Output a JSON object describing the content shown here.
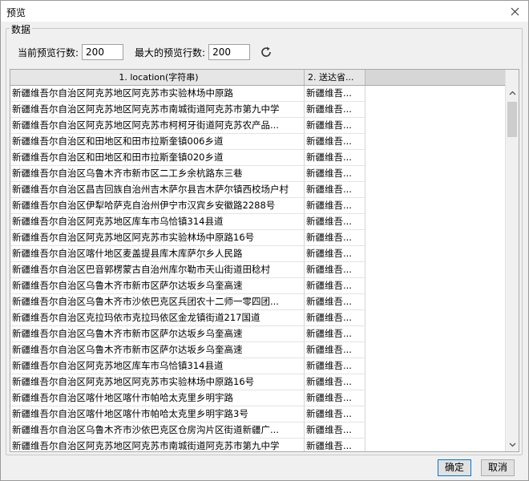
{
  "window": {
    "title": "预览"
  },
  "group": {
    "legend": "数据"
  },
  "controls": {
    "current_label": "当前预览行数:",
    "current_value": "200",
    "max_label": "最大的预览行数:",
    "max_value": "200"
  },
  "table": {
    "columns": [
      "1. location(字符串)",
      "2. 送达省..."
    ],
    "rows": [
      [
        "新疆维吾尔自治区阿克苏地区阿克苏市实验林场中原路",
        "新疆维吾..."
      ],
      [
        "新疆维吾尔自治区阿克苏地区阿克苏市南城街道阿克苏市第九中学",
        "新疆维吾..."
      ],
      [
        "新疆维吾尔自治区阿克苏地区阿克苏市柯柯牙街道阿克苏农产品...",
        "新疆维吾..."
      ],
      [
        "新疆维吾尔自治区和田地区和田市拉斯奎镇006乡道",
        "新疆维吾..."
      ],
      [
        "新疆维吾尔自治区和田地区和田市拉斯奎镇020乡道",
        "新疆维吾..."
      ],
      [
        "新疆维吾尔自治区乌鲁木齐市新市区二工乡余杭路东三巷",
        "新疆维吾..."
      ],
      [
        "新疆维吾尔自治区昌吉回族自治州吉木萨尔县吉木萨尔镇西校场户村",
        "新疆维吾..."
      ],
      [
        "新疆维吾尔自治区伊犁哈萨克自治州伊宁市汉宾乡安徽路2288号",
        "新疆维吾..."
      ],
      [
        "新疆维吾尔自治区阿克苏地区库车市乌恰镇314县道",
        "新疆维吾..."
      ],
      [
        "新疆维吾尔自治区阿克苏地区阿克苏市实验林场中原路16号",
        "新疆维吾..."
      ],
      [
        "新疆维吾尔自治区喀什地区麦盖提县库木库萨尔乡人民路",
        "新疆维吾..."
      ],
      [
        "新疆维吾尔自治区巴音郭楞蒙古自治州库尔勒市天山街道田稔村",
        "新疆维吾..."
      ],
      [
        "新疆维吾尔自治区乌鲁木齐市新市区萨尔达坂乡乌奎高速",
        "新疆维吾..."
      ],
      [
        "新疆维吾尔自治区乌鲁木齐市沙依巴克区兵团农十二师一零四团...",
        "新疆维吾..."
      ],
      [
        "新疆维吾尔自治区克拉玛依市克拉玛依区金龙镇街道217国道",
        "新疆维吾..."
      ],
      [
        "新疆维吾尔自治区乌鲁木齐市新市区萨尔达坂乡乌奎高速",
        "新疆维吾..."
      ],
      [
        "新疆维吾尔自治区乌鲁木齐市新市区萨尔达坂乡乌奎高速",
        "新疆维吾..."
      ],
      [
        "新疆维吾尔自治区阿克苏地区库车市乌恰镇314县道",
        "新疆维吾..."
      ],
      [
        "新疆维吾尔自治区阿克苏地区阿克苏市实验林场中原路16号",
        "新疆维吾..."
      ],
      [
        "新疆维吾尔自治区喀什地区喀什市帕哈太克里乡明宇路",
        "新疆维吾..."
      ],
      [
        "新疆维吾尔自治区喀什地区喀什市帕哈太克里乡明宇路3号",
        "新疆维吾..."
      ],
      [
        "新疆维吾尔自治区乌鲁木齐市沙依巴克区仓房沟片区街道新疆广...",
        "新疆维吾..."
      ],
      [
        "新疆维吾尔自治区阿克苏地区阿克苏市南城街道阿克苏市第九中学",
        "新疆维吾..."
      ]
    ]
  },
  "buttons": {
    "ok": "确定",
    "cancel": "取消"
  },
  "icons": {
    "close": "close-icon",
    "refresh": "refresh-icon",
    "scroll_up": "chevron-up-icon",
    "scroll_down": "chevron-down-icon"
  }
}
